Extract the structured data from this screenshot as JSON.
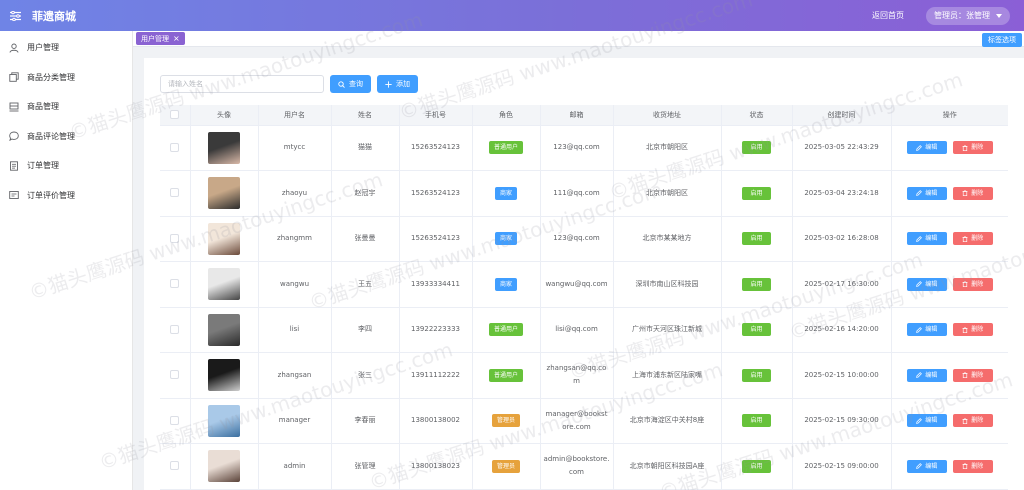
{
  "app": {
    "brand": "菲遗商城",
    "back_home": "返回首页",
    "admin_label": "管理员：张管理"
  },
  "sidebar": {
    "items": [
      {
        "label": "用户管理",
        "icon": "user-icon"
      },
      {
        "label": "商品分类管理",
        "icon": "category-icon"
      },
      {
        "label": "商品管理",
        "icon": "goods-icon"
      },
      {
        "label": "商品评论管理",
        "icon": "comment-icon"
      },
      {
        "label": "订单管理",
        "icon": "order-icon"
      },
      {
        "label": "订单评价管理",
        "icon": "review-icon"
      }
    ]
  },
  "tabs": {
    "active": {
      "label": "用户管理",
      "close": "×"
    },
    "options_label": "标签选项"
  },
  "search": {
    "placeholder": "请输入姓名",
    "value": "",
    "search_label": "查询",
    "add_label": "添加"
  },
  "table": {
    "headers": [
      "",
      "头像",
      "用户名",
      "姓名",
      "手机号",
      "角色",
      "邮箱",
      "收货地址",
      "状态",
      "创建时间",
      "操作"
    ],
    "edit_label": "编辑",
    "delete_label": "删除",
    "rows": [
      {
        "username": "mtycc",
        "name": "猫猫",
        "phone": "15263524123",
        "role": "普通用户",
        "role_color": "#67c23a",
        "email": "123@qq.com",
        "address": "北京市朝阳区",
        "status": "启用",
        "created": "2025-03-05 22:43:29",
        "avatar": [
          "#3a3a3a",
          "#d9b9a8"
        ]
      },
      {
        "username": "zhaoyu",
        "name": "赵冠宇",
        "phone": "15263524123",
        "role": "商家",
        "role_color": "#409eff",
        "email": "111@qq.com",
        "address": "北京市朝阳区",
        "status": "启用",
        "created": "2025-03-04 23:24:18",
        "avatar": [
          "#c8a888",
          "#2b2b2b"
        ]
      },
      {
        "username": "zhangmm",
        "name": "张曼曼",
        "phone": "15263524123",
        "role": "商家",
        "role_color": "#409eff",
        "email": "123@qq.com",
        "address": "北京市某某地方",
        "status": "启用",
        "created": "2025-03-02 16:28:08",
        "avatar": [
          "#f2e6da",
          "#6b4a3a"
        ]
      },
      {
        "username": "wangwu",
        "name": "王五",
        "phone": "13933334411",
        "role": "商家",
        "role_color": "#409eff",
        "email": "wangwu@qq.com",
        "address": "深圳市南山区科技园",
        "status": "启用",
        "created": "2025-02-17 16:30:00",
        "avatar": [
          "#e8e8e8",
          "#444444"
        ]
      },
      {
        "username": "lisi",
        "name": "李四",
        "phone": "13922223333",
        "role": "普通用户",
        "role_color": "#67c23a",
        "email": "lisi@qq.com",
        "address": "广州市天河区珠江新城",
        "status": "启用",
        "created": "2025-02-16 14:20:00",
        "avatar": [
          "#7a7a7a",
          "#2a2a2a"
        ]
      },
      {
        "username": "zhangsan",
        "name": "张三",
        "phone": "13911112222",
        "role": "普通用户",
        "role_color": "#67c23a",
        "email": "zhangsan@qq.com",
        "address": "上海市浦东新区陆家嘴",
        "status": "启用",
        "created": "2025-02-15 10:00:00",
        "avatar": [
          "#1a1a1a",
          "#cfcfcf"
        ]
      },
      {
        "username": "manager",
        "name": "李春丽",
        "phone": "13800138002",
        "role": "管理员",
        "role_color": "#e6a23c",
        "email": "manager@bookstore.com",
        "address": "北京市海淀区中关村8座",
        "status": "启用",
        "created": "2025-02-15 09:30:00",
        "avatar": [
          "#a9c9e8",
          "#3b6fa0"
        ]
      },
      {
        "username": "admin",
        "name": "张管理",
        "phone": "13800138023",
        "role": "管理员",
        "role_color": "#e6a23c",
        "email": "admin@bookstore.com",
        "address": "北京市朝阳区科技园A座",
        "status": "启用",
        "created": "2025-02-15 09:00:00",
        "avatar": [
          "#e9ddd5",
          "#5a4238"
        ]
      }
    ]
  },
  "watermark": "©猫头鹰源码 www.maotouyingcc.com",
  "colors": {
    "primary": "#409eff",
    "success": "#67c23a",
    "warning": "#e6a23c",
    "danger": "#f56c6c",
    "header_start": "#6f84e6",
    "header_end": "#8b5fd6",
    "tab_active": "#8a63d2"
  }
}
